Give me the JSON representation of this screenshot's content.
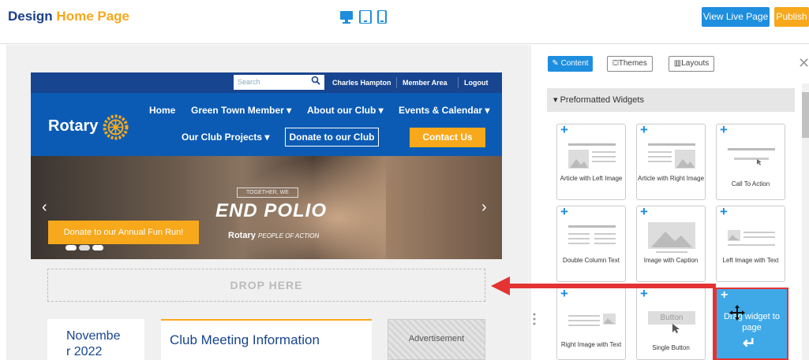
{
  "topbar": {
    "title_prefix": "Design",
    "title_highlight": "Home Page",
    "devices": [
      "desktop-icon",
      "tablet-icon",
      "mobile-icon"
    ],
    "view_live_label": "View Live Page",
    "publish_label": "Publish"
  },
  "site": {
    "search_placeholder": "Search",
    "user_name": "Charles Hampton",
    "member_area": "Member Area",
    "logout": "Logout",
    "logo_text": "Rotary",
    "nav": {
      "home": "Home",
      "green_town": "Green Town Member",
      "about": "About our Club",
      "events": "Events & Calendar",
      "projects": "Our Club Projects",
      "donate": "Donate to our Club",
      "contact": "Contact Us"
    },
    "hero": {
      "tag": "TOGETHER, WE",
      "title": "END POLIO",
      "sub_logo": "Rotary",
      "sub_tag": "PEOPLE OF ACTION",
      "cta": "Donate to our Annual Fun Run!"
    },
    "drop_here": "DROP HERE",
    "date": "November 2022",
    "meeting_title": "Club Meeting Information",
    "advertisement": "Advertisement"
  },
  "panel": {
    "tabs": {
      "content": "Content",
      "themes": "Themes",
      "layouts": "Layouts"
    },
    "accordion": "Preformatted Widgets",
    "widgets": [
      {
        "label": "Article with Left Image"
      },
      {
        "label": "Article with Right Image"
      },
      {
        "label": "Call To Action"
      },
      {
        "label": "Double Column Text"
      },
      {
        "label": "Image with Caption"
      },
      {
        "label": "Left Image with Text"
      },
      {
        "label": "Right Image with Text"
      },
      {
        "label": "Single Button"
      }
    ],
    "single_button_preview": "Button",
    "drag_text": "Drag widget to page"
  },
  "colors": {
    "accent": "#1e8ede",
    "rotary_blue": "#17458f",
    "rotary_gold": "#f7a81b",
    "arrow_red": "#e43333"
  }
}
